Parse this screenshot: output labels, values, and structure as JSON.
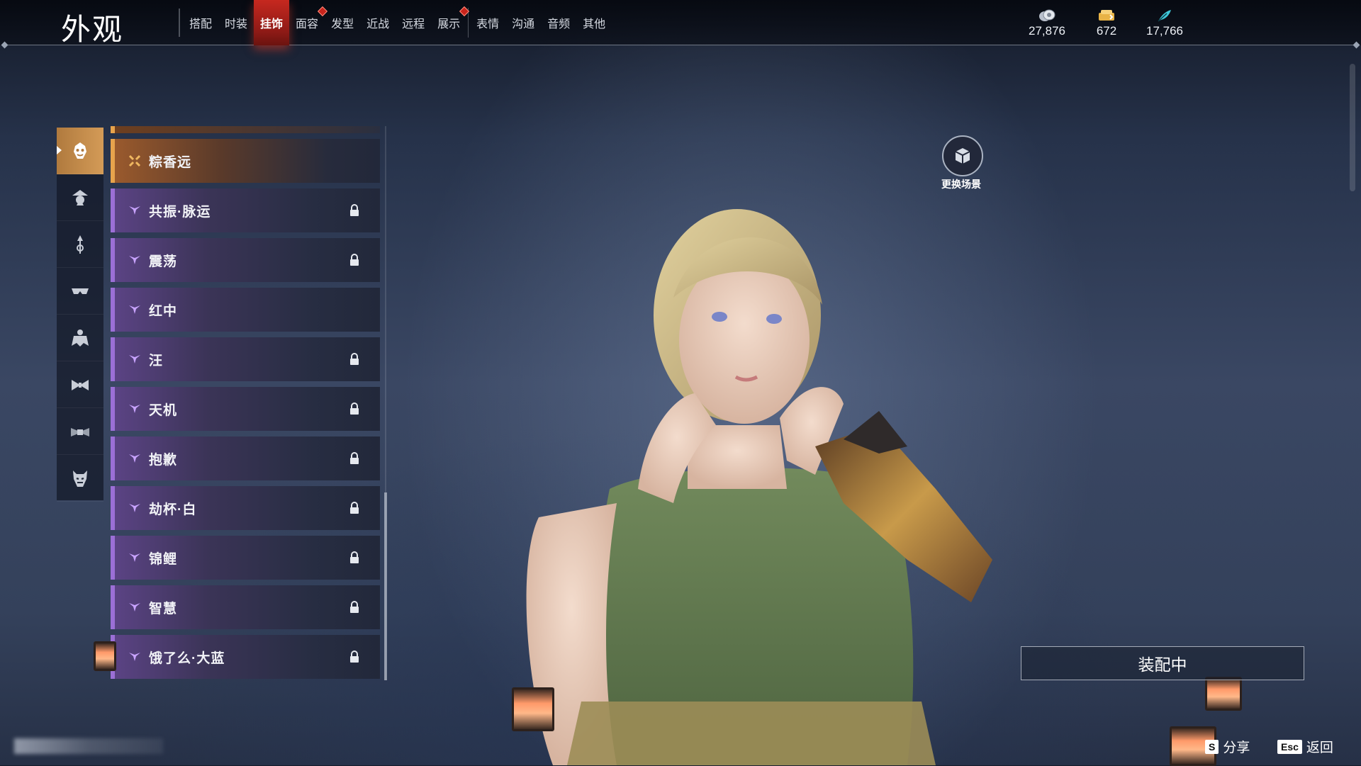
{
  "header": {
    "title": "外观",
    "tabs": [
      {
        "label": "搭配",
        "active": false,
        "dot": false
      },
      {
        "label": "时装",
        "active": false,
        "dot": false
      },
      {
        "label": "挂饰",
        "active": true,
        "dot": false
      },
      {
        "label": "面容",
        "active": false,
        "dot": true
      },
      {
        "label": "发型",
        "active": false,
        "dot": false
      },
      {
        "label": "近战",
        "active": false,
        "dot": false
      },
      {
        "label": "远程",
        "active": false,
        "dot": false
      },
      {
        "label": "展示",
        "active": false,
        "dot": true
      },
      {
        "label": "表情",
        "active": false,
        "dot": false
      },
      {
        "label": "沟通",
        "active": false,
        "dot": false
      },
      {
        "label": "音频",
        "active": false,
        "dot": false
      },
      {
        "label": "其他",
        "active": false,
        "dot": false
      }
    ],
    "currencies": [
      {
        "icon": "coin-icon",
        "value": "27,876"
      },
      {
        "icon": "ticket-icon",
        "value": "672"
      },
      {
        "icon": "feather-icon",
        "value": "17,766"
      }
    ]
  },
  "categories": [
    {
      "icon": "mask-icon",
      "active": true
    },
    {
      "icon": "hat-icon",
      "active": false
    },
    {
      "icon": "hairpin-icon",
      "active": false
    },
    {
      "icon": "eyewear-icon",
      "active": false
    },
    {
      "icon": "cape-icon",
      "active": false
    },
    {
      "icon": "bow-icon",
      "active": false
    },
    {
      "icon": "belt-icon",
      "active": false
    },
    {
      "icon": "demon-mask-icon",
      "active": false
    }
  ],
  "items": [
    {
      "name": "粽香远",
      "locked": false,
      "selected": true
    },
    {
      "name": "共振·脉运",
      "locked": true,
      "selected": false
    },
    {
      "name": "震荡",
      "locked": true,
      "selected": false
    },
    {
      "name": "红中",
      "locked": false,
      "selected": false
    },
    {
      "name": "汪",
      "locked": true,
      "selected": false
    },
    {
      "name": "天机",
      "locked": true,
      "selected": false
    },
    {
      "name": "抱歉",
      "locked": true,
      "selected": false
    },
    {
      "name": "劫杯·白",
      "locked": true,
      "selected": false
    },
    {
      "name": "锦鲤",
      "locked": true,
      "selected": false
    },
    {
      "name": "智慧",
      "locked": true,
      "selected": false
    },
    {
      "name": "饿了么·大蓝",
      "locked": true,
      "selected": false
    }
  ],
  "scene": {
    "label": "更换场景"
  },
  "equip": {
    "label": "装配中"
  },
  "hints": {
    "share": {
      "key": "S",
      "label": "分享"
    },
    "back": {
      "key": "Esc",
      "label": "返回"
    }
  },
  "colors": {
    "active_tab": "#c6281f",
    "rare_purple": "#9b6fd6",
    "legendary_gold": "#e7a34c"
  }
}
